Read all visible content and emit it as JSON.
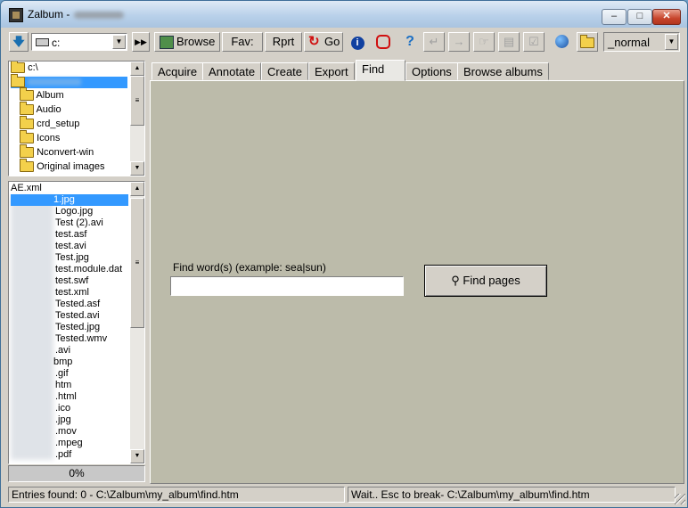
{
  "window": {
    "title": "Zalbum -",
    "min": "–",
    "max": "□",
    "close": "✕"
  },
  "toolbar": {
    "drive": "c:",
    "browse": "Browse",
    "fav": "Fav:",
    "rprt": "Rprt",
    "go": "Go",
    "mode": "_normal"
  },
  "folders": {
    "path": "c:\\",
    "items": [
      "Album",
      "Audio",
      "crd_setup",
      "Icons",
      "Nconvert-win",
      "Original images"
    ]
  },
  "files": {
    "header": "AE.xml",
    "items": [
      "1.jpg",
      "Logo.jpg",
      "Test (2).avi",
      "test.asf",
      "test.avi",
      "Test.jpg",
      "test.module.dat",
      "test.swf",
      "test.xml",
      "Tested.asf",
      "Tested.avi",
      "Tested.jpg",
      "Tested.wmv",
      ".avi",
      "bmp",
      ".gif",
      "htm",
      ".html",
      ".ico",
      ".jpg",
      ".mov",
      ".mpeg",
      ".pdf"
    ]
  },
  "progress": "0%",
  "tabs": [
    "Acquire",
    "Annotate",
    "Create",
    "Export",
    "Find",
    "Options",
    "Browse albums"
  ],
  "find": {
    "label": "Find word(s) (example: sea|sun)",
    "value": "",
    "button": "Find pages"
  },
  "status": {
    "left": "Entries found: 0 - C:\\Zalbum\\my_album\\find.htm",
    "right": "Wait.. Esc to break- C:\\Zalbum\\my_album\\find.htm"
  },
  "colors": {
    "content_bg": "#bcbbaa",
    "selection": "#3399ff",
    "close_red": "#c7452c"
  }
}
